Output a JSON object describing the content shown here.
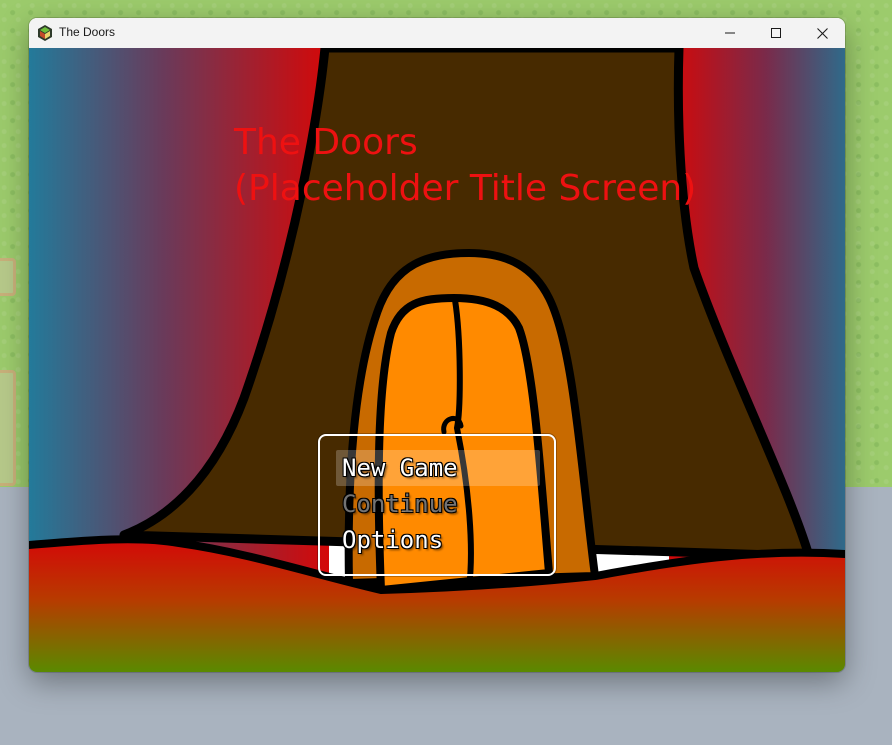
{
  "window": {
    "title": "The Doors",
    "icon": "app-icon",
    "controls": {
      "minimize": "—",
      "maximize": "☐",
      "close": "✕"
    }
  },
  "game": {
    "title_line1": "The Doors",
    "title_line2": "(Placeholder Title Screen)",
    "title_color": "#ee1111",
    "menu": {
      "selected_index": 0,
      "items": [
        {
          "label": "New Game",
          "enabled": true
        },
        {
          "label": "Continue",
          "enabled": false
        },
        {
          "label": "Options",
          "enabled": true
        }
      ]
    }
  },
  "colors": {
    "tree": "#472a00",
    "door": "#ff8a00",
    "door_frame": "#c86a00",
    "curtain_red": "#d01010",
    "curtain_blue": "#2a7a9a",
    "ground_top": "#d40808",
    "ground_bottom": "#5a8a00"
  }
}
